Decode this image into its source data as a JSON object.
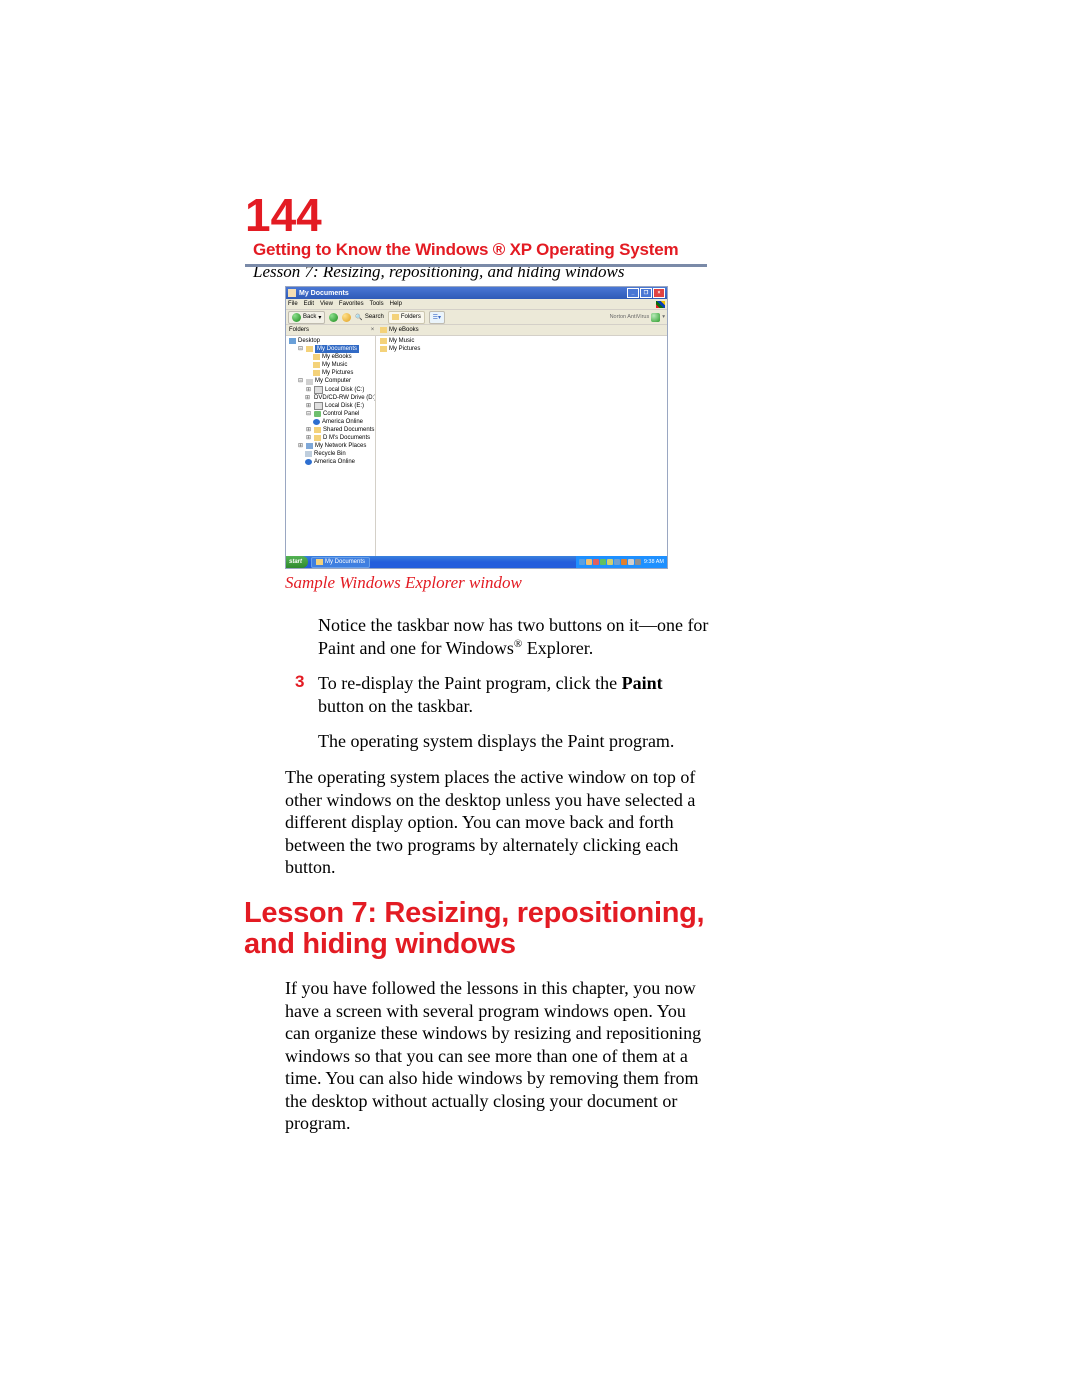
{
  "header": {
    "page_number": "144",
    "chapter": "Getting to Know the Windows ® XP Operating System",
    "subtitle": "Lesson 7: Resizing, repositioning, and hiding windows"
  },
  "figure": {
    "caption": "Sample Windows Explorer window",
    "titlebar": "My Documents",
    "menus": [
      "File",
      "Edit",
      "View",
      "Favorites",
      "Tools",
      "Help"
    ],
    "toolbar": {
      "back": "Back",
      "search": "Search",
      "folders": "Folders",
      "right_label": "Norton AntiVirus"
    },
    "subhead": {
      "folders": "Folders",
      "close": "×",
      "content_first": "My eBooks"
    },
    "tree": {
      "desktop": "Desktop",
      "mydocs": "My Documents",
      "myebooks": "My eBooks",
      "mymusic": "My Music",
      "mypictures": "My Pictures",
      "mycomputer": "My Computer",
      "localc": "Local Disk (C:)",
      "dvd": "DVD/CD-RW Drive (D:)",
      "locale": "Local Disk (E:)",
      "cpanel": "Control Panel",
      "aol1": "America Online",
      "shared": "Shared Documents",
      "dm": "D M's Documents",
      "netplaces": "My Network Places",
      "recycle": "Recycle Bin",
      "aol2": "America Online"
    },
    "content": {
      "mymusic": "My Music",
      "mypictures": "My Pictures"
    },
    "taskbar": {
      "start": "start",
      "item": "My Documents",
      "clock": "9:38 AM"
    }
  },
  "body": {
    "p1a": "Notice the taskbar now has two buttons on it—one for Paint and one for Windows",
    "p1b": " Explorer.",
    "step3_num": "3",
    "step3a": "To re-display the Paint program, click the ",
    "step3b": "Paint",
    "step3c": " button on the taskbar.",
    "p2": "The operating system displays the Paint program.",
    "p3": "The operating system places the active window on top of other windows on the desktop unless you have selected a different display option. You can move back and forth between the two programs by alternately clicking each button."
  },
  "lesson_heading": "Lesson 7: Resizing, repositioning, and hiding windows",
  "lesson_body": "If you have followed the lessons in this chapter, you now have a screen with several program windows open. You can organize these windows by resizing and repositioning windows so that you can see more than one of them at a time. You can also hide windows by removing them from the desktop without actually closing your document or program."
}
